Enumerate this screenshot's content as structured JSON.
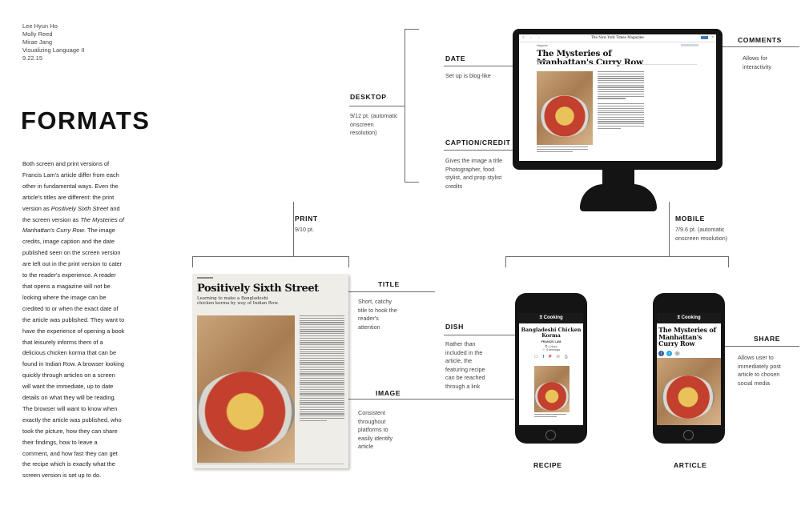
{
  "authors": [
    "Lee Hyun Ho",
    "Molly Reed",
    "Mirae Jang",
    "Visualizing Language II",
    "9.22.15"
  ],
  "title": "FORMATS",
  "body": [
    {
      "t": "Both screen and print versions of Francis Lam's article differ from each other in fundamental ways. Even the article's titles are different: the print version as ",
      "i": false
    },
    {
      "t": "Positively Sixth Street",
      "i": true
    },
    {
      "t": " and the screen version as ",
      "i": false
    },
    {
      "t": "The Mysteries of Manhattan's Curry Row",
      "i": true
    },
    {
      "t": ". The image credits, image caption and the date published seen on the screen version are left out in the print version to cater to the reader's experience. A reader that opens a magazine will not be looking where the image can be credited to or when the exact date of the article was published. They want to have the experience of opening a book that leisurely informs them of a delicious chicken korma that can be found in Indian Row. A browser looking quickly through articles on a screen will want the immediate, up to date details on what they will be reading. The browser will want to know when exactly the article was published, who took the picture, how they can share their findings, how to leave a comment, and how fast they can get the recipe which is exactly what the screen version is set up to do.",
      "i": false
    }
  ],
  "labels": {
    "desktop": "DESKTOP",
    "desktop_note": "9/12 pt. (automatic onscreen resolution)",
    "date": "DATE",
    "date_note": "Set up is blog-like",
    "caption": "CAPTION/CREDIT",
    "caption_note": "Gives the image a title Photographer, food stylist, and prop stylist credits",
    "comments": "COMMENTS",
    "comments_note": "Allows for interactivity",
    "print": "PRINT",
    "print_note": "9/10 pt.",
    "mobile": "MOBILE",
    "mobile_note": "7/9.6 pt. (automatic onscreen resolution)",
    "title": "TITLE",
    "title_note": "Short, catchy title to hook the reader's attention",
    "image": "IMAGE",
    "image_note": "Consistent throughout platforms to easily identify article",
    "dish": "DISH",
    "dish_note": "Rather than included in the article, the featuring recipe can be reached through a link",
    "share": "SHARE",
    "share_note": "Allows user to immediately post article to chosen social media",
    "recipe": "RECIPE",
    "article": "ARTICLE"
  },
  "desktop_screen": {
    "masthead": "The New York Times Magazine",
    "section": "Magazine",
    "headline": "The Mysteries of Manhattan's Curry Row"
  },
  "magazine_page": {
    "headline": "Positively Sixth Street",
    "deck": "Learning to make a Bangladeshi chicken korma by way of Indian Row."
  },
  "recipe_phone": {
    "app": "Cooking",
    "dish": "Bangladeshi Chicken Korma",
    "author": "FRANCIS LAM",
    "time": "1 Hour",
    "servings": "4 servings"
  },
  "article_phone": {
    "app": "Cooking",
    "headline": "The Mysteries of Manhattan's Curry Row"
  }
}
